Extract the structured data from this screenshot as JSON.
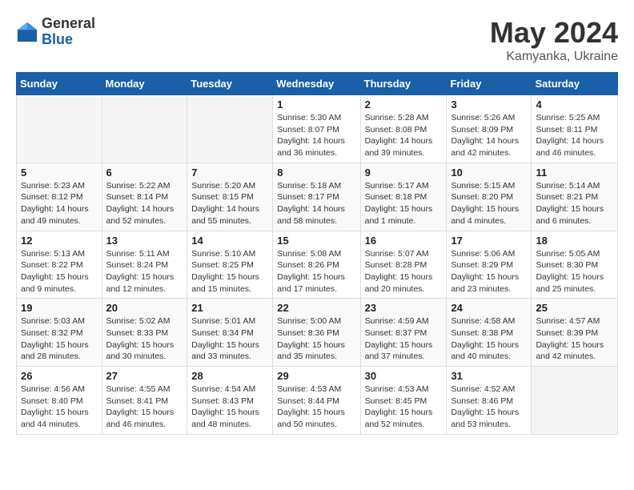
{
  "logo": {
    "general": "General",
    "blue": "Blue"
  },
  "title": "May 2024",
  "location": "Kamyanka, Ukraine",
  "weekdays": [
    "Sunday",
    "Monday",
    "Tuesday",
    "Wednesday",
    "Thursday",
    "Friday",
    "Saturday"
  ],
  "weeks": [
    [
      {
        "day": "",
        "info": ""
      },
      {
        "day": "",
        "info": ""
      },
      {
        "day": "",
        "info": ""
      },
      {
        "day": "1",
        "info": "Sunrise: 5:30 AM\nSunset: 8:07 PM\nDaylight: 14 hours\nand 36 minutes."
      },
      {
        "day": "2",
        "info": "Sunrise: 5:28 AM\nSunset: 8:08 PM\nDaylight: 14 hours\nand 39 minutes."
      },
      {
        "day": "3",
        "info": "Sunrise: 5:26 AM\nSunset: 8:09 PM\nDaylight: 14 hours\nand 42 minutes."
      },
      {
        "day": "4",
        "info": "Sunrise: 5:25 AM\nSunset: 8:11 PM\nDaylight: 14 hours\nand 46 minutes."
      }
    ],
    [
      {
        "day": "5",
        "info": "Sunrise: 5:23 AM\nSunset: 8:12 PM\nDaylight: 14 hours\nand 49 minutes."
      },
      {
        "day": "6",
        "info": "Sunrise: 5:22 AM\nSunset: 8:14 PM\nDaylight: 14 hours\nand 52 minutes."
      },
      {
        "day": "7",
        "info": "Sunrise: 5:20 AM\nSunset: 8:15 PM\nDaylight: 14 hours\nand 55 minutes."
      },
      {
        "day": "8",
        "info": "Sunrise: 5:18 AM\nSunset: 8:17 PM\nDaylight: 14 hours\nand 58 minutes."
      },
      {
        "day": "9",
        "info": "Sunrise: 5:17 AM\nSunset: 8:18 PM\nDaylight: 15 hours\nand 1 minute."
      },
      {
        "day": "10",
        "info": "Sunrise: 5:15 AM\nSunset: 8:20 PM\nDaylight: 15 hours\nand 4 minutes."
      },
      {
        "day": "11",
        "info": "Sunrise: 5:14 AM\nSunset: 8:21 PM\nDaylight: 15 hours\nand 6 minutes."
      }
    ],
    [
      {
        "day": "12",
        "info": "Sunrise: 5:13 AM\nSunset: 8:22 PM\nDaylight: 15 hours\nand 9 minutes."
      },
      {
        "day": "13",
        "info": "Sunrise: 5:11 AM\nSunset: 8:24 PM\nDaylight: 15 hours\nand 12 minutes."
      },
      {
        "day": "14",
        "info": "Sunrise: 5:10 AM\nSunset: 8:25 PM\nDaylight: 15 hours\nand 15 minutes."
      },
      {
        "day": "15",
        "info": "Sunrise: 5:08 AM\nSunset: 8:26 PM\nDaylight: 15 hours\nand 17 minutes."
      },
      {
        "day": "16",
        "info": "Sunrise: 5:07 AM\nSunset: 8:28 PM\nDaylight: 15 hours\nand 20 minutes."
      },
      {
        "day": "17",
        "info": "Sunrise: 5:06 AM\nSunset: 8:29 PM\nDaylight: 15 hours\nand 23 minutes."
      },
      {
        "day": "18",
        "info": "Sunrise: 5:05 AM\nSunset: 8:30 PM\nDaylight: 15 hours\nand 25 minutes."
      }
    ],
    [
      {
        "day": "19",
        "info": "Sunrise: 5:03 AM\nSunset: 8:32 PM\nDaylight: 15 hours\nand 28 minutes."
      },
      {
        "day": "20",
        "info": "Sunrise: 5:02 AM\nSunset: 8:33 PM\nDaylight: 15 hours\nand 30 minutes."
      },
      {
        "day": "21",
        "info": "Sunrise: 5:01 AM\nSunset: 8:34 PM\nDaylight: 15 hours\nand 33 minutes."
      },
      {
        "day": "22",
        "info": "Sunrise: 5:00 AM\nSunset: 8:36 PM\nDaylight: 15 hours\nand 35 minutes."
      },
      {
        "day": "23",
        "info": "Sunrise: 4:59 AM\nSunset: 8:37 PM\nDaylight: 15 hours\nand 37 minutes."
      },
      {
        "day": "24",
        "info": "Sunrise: 4:58 AM\nSunset: 8:38 PM\nDaylight: 15 hours\nand 40 minutes."
      },
      {
        "day": "25",
        "info": "Sunrise: 4:57 AM\nSunset: 8:39 PM\nDaylight: 15 hours\nand 42 minutes."
      }
    ],
    [
      {
        "day": "26",
        "info": "Sunrise: 4:56 AM\nSunset: 8:40 PM\nDaylight: 15 hours\nand 44 minutes."
      },
      {
        "day": "27",
        "info": "Sunrise: 4:55 AM\nSunset: 8:41 PM\nDaylight: 15 hours\nand 46 minutes."
      },
      {
        "day": "28",
        "info": "Sunrise: 4:54 AM\nSunset: 8:43 PM\nDaylight: 15 hours\nand 48 minutes."
      },
      {
        "day": "29",
        "info": "Sunrise: 4:53 AM\nSunset: 8:44 PM\nDaylight: 15 hours\nand 50 minutes."
      },
      {
        "day": "30",
        "info": "Sunrise: 4:53 AM\nSunset: 8:45 PM\nDaylight: 15 hours\nand 52 minutes."
      },
      {
        "day": "31",
        "info": "Sunrise: 4:52 AM\nSunset: 8:46 PM\nDaylight: 15 hours\nand 53 minutes."
      },
      {
        "day": "",
        "info": ""
      }
    ]
  ]
}
